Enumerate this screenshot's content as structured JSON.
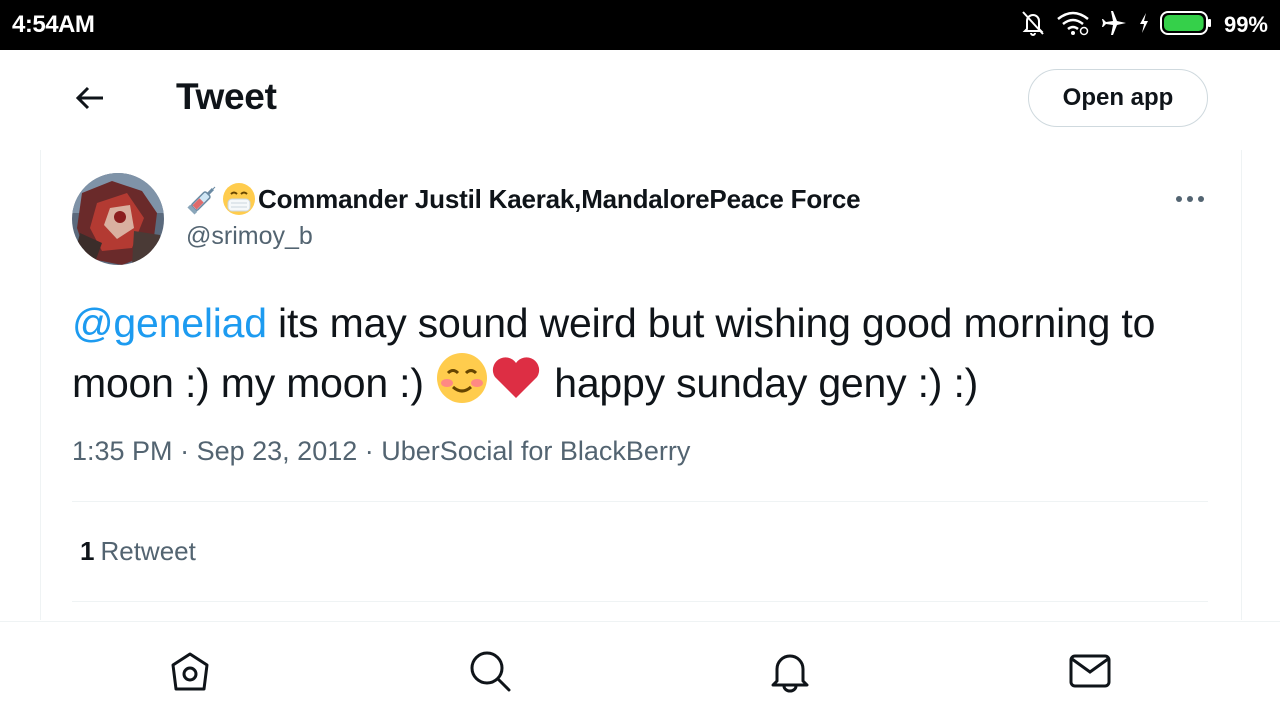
{
  "status_bar": {
    "time": "4:54AM",
    "battery_percent": "99%",
    "battery_level": 0.99,
    "icons": [
      "notifications-off-icon",
      "wifi-icon",
      "airplane-icon",
      "charging-icon",
      "battery-icon"
    ]
  },
  "header": {
    "title": "Tweet",
    "open_app_label": "Open app"
  },
  "tweet": {
    "author": {
      "name_emoji": [
        "syringe-emoji",
        "mask-face-emoji"
      ],
      "display_name": "Commander Justil Kaerak,MandalorePeace Force",
      "handle": "@srimoy_b"
    },
    "text": {
      "mention": "@geneliad",
      "part1": " its may sound weird but wishing good morning to moon :) my moon :) ",
      "emojis": [
        "smiling-face-emoji",
        "red-heart-emoji"
      ],
      "part2": " happy sunday geny :) :)"
    },
    "time": "1:35 PM",
    "date": "Sep 23, 2012",
    "separator": "·",
    "source": "UberSocial for BlackBerry",
    "retweet_count": "1",
    "retweet_label": "Retweet"
  },
  "tab_bar": {
    "tabs": [
      "home-icon",
      "search-icon",
      "notifications-icon",
      "messages-icon"
    ]
  },
  "colors": {
    "accent": "#1d9bf0",
    "text_primary": "#0f1419",
    "text_secondary": "#536471",
    "border": "#eff3f4"
  }
}
